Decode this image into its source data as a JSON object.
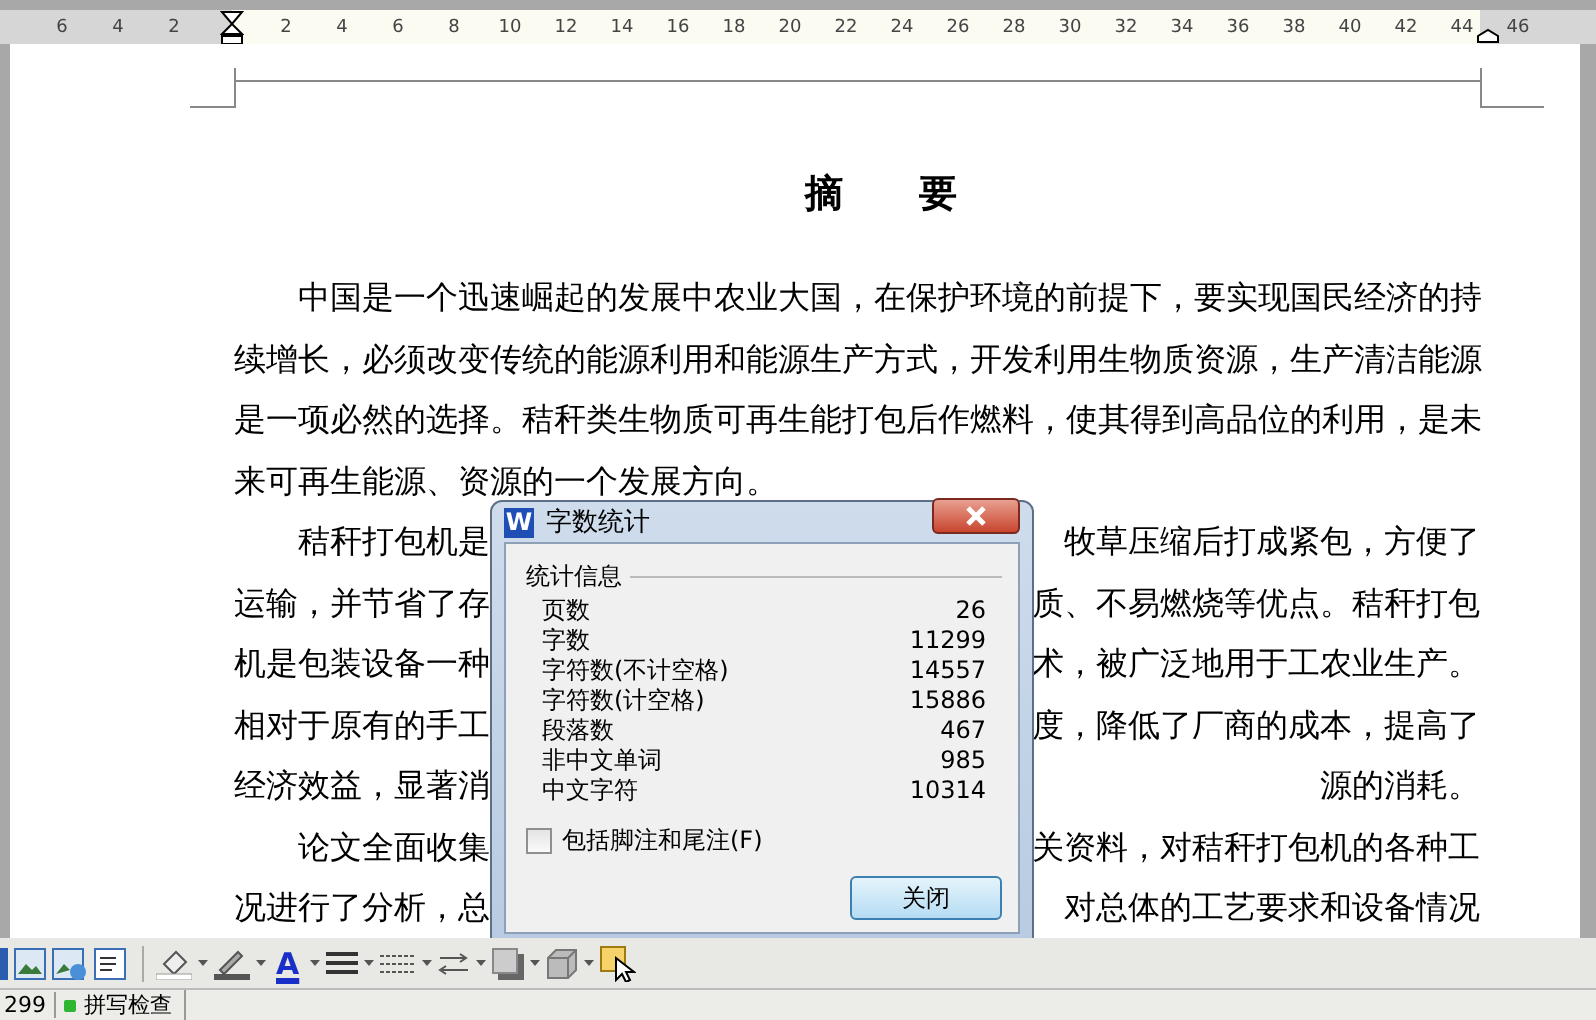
{
  "ruler": {
    "left_numbers": [
      "6",
      "4",
      "2"
    ],
    "numbers": [
      "2",
      "4",
      "6",
      "8",
      "10",
      "12",
      "14",
      "16",
      "18",
      "20",
      "22",
      "24",
      "26",
      "28",
      "30",
      "32",
      "34",
      "36",
      "38",
      "40",
      "42",
      "44",
      "46"
    ]
  },
  "document": {
    "title": "摘　　要",
    "lines": [
      {
        "indent": true,
        "left": "中国是一个迅速崛起的发展中农业大国，在保护环境的前提下，要实现国民经济的持"
      },
      {
        "indent": false,
        "left": "续增长，必须改变传统的能源利用和能源生产方式，开发利用生物质资源，生产清洁能源"
      },
      {
        "indent": false,
        "left": "是一项必然的选择。秸秆类生物质可再生能打包后作燃料，使其得到高品位的利用，是未"
      },
      {
        "indent": false,
        "left": "来可再生能源、资源的一个发展方向。"
      },
      {
        "indent": true,
        "left": "秸秆打包机是",
        "right": "牧草压缩后打成紧包，方便了"
      },
      {
        "indent": false,
        "left": "运输，并节省了存",
        "right": "质、不易燃烧等优点。秸秆打包"
      },
      {
        "indent": false,
        "left": "机是包装设备一种",
        "right": "术，被广泛地用于工农业生产。"
      },
      {
        "indent": false,
        "left": "相对于原有的手工",
        "right": "度，降低了厂商的成本，提高了"
      },
      {
        "indent": false,
        "left": "经济效益，显著消",
        "right": "源的消耗。"
      },
      {
        "indent": true,
        "left": "论文全面收集",
        "right": "关资料，对秸秆打包机的各种工"
      },
      {
        "indent": false,
        "left": "况进行了分析，总",
        "right": "对总体的工艺要求和设备情况"
      }
    ]
  },
  "dialog": {
    "icon_text": "W",
    "title": "字数统计",
    "group": "统计信息",
    "stats": [
      {
        "label": "页数",
        "value": "26"
      },
      {
        "label": "字数",
        "value": "11299"
      },
      {
        "label": "字符数(不计空格)",
        "value": "14557"
      },
      {
        "label": "字符数(计空格)",
        "value": "15886"
      },
      {
        "label": "段落数",
        "value": "467"
      },
      {
        "label": "非中文单词",
        "value": "985"
      },
      {
        "label": "中文字符",
        "value": "10314"
      }
    ],
    "checkbox": {
      "label": "包括脚注和尾注(F)",
      "checked": false
    },
    "button": "关闭"
  },
  "toolbar": {
    "font_color_letter": "A"
  },
  "status_bar": {
    "page": "299",
    "spell_check": "拼写检查"
  }
}
